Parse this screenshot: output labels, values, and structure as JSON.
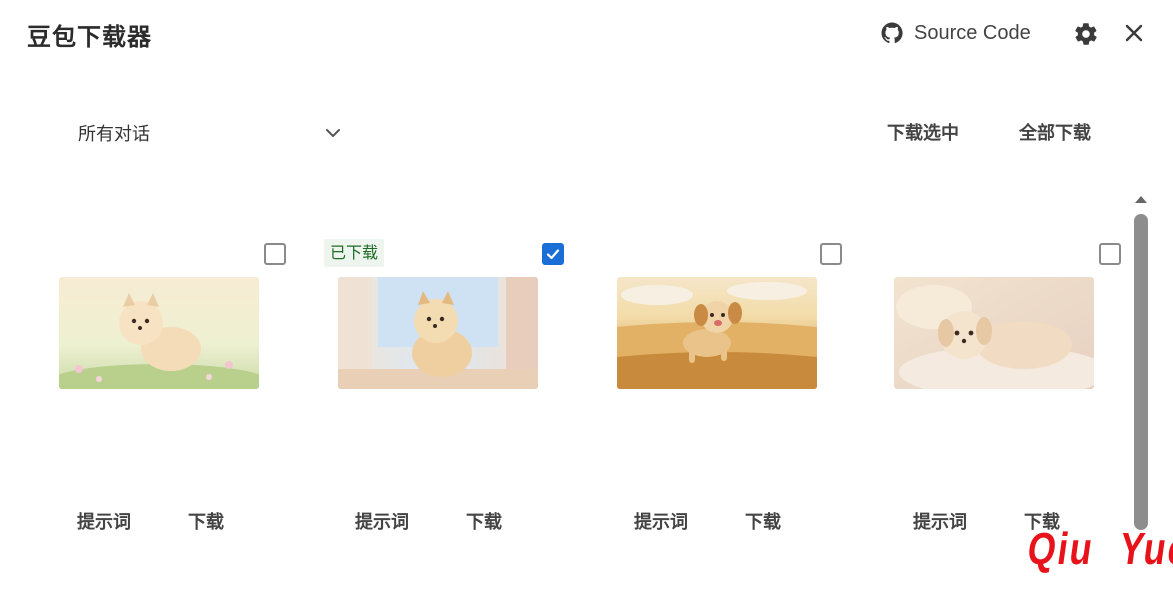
{
  "header": {
    "title": "豆包下载器",
    "source_code_label": "Source Code",
    "icons": {
      "github": "github-icon",
      "settings": "gear-icon",
      "close": "close-icon"
    }
  },
  "toolbar": {
    "conversation_filter": "所有对话",
    "download_selected_label": "下载选中",
    "download_all_label": "全部下载"
  },
  "cards": [
    {
      "checked": false,
      "downloaded": false,
      "badge": "",
      "prompt_label": "提示词",
      "download_label": "下载",
      "image_subject": "pomeranian-in-flower-field"
    },
    {
      "checked": true,
      "downloaded": true,
      "badge": "已下载",
      "prompt_label": "提示词",
      "download_label": "下载",
      "image_subject": "pomeranian-by-window"
    },
    {
      "checked": false,
      "downloaded": false,
      "badge": "",
      "prompt_label": "提示词",
      "download_label": "下载",
      "image_subject": "puppy-running-in-wheat-field"
    },
    {
      "checked": false,
      "downloaded": false,
      "badge": "",
      "prompt_label": "提示词",
      "download_label": "下载",
      "image_subject": "puppy-lying-on-pillow"
    }
  ],
  "colors": {
    "accent": "#1a6fd6",
    "badge_text": "#1f6b26",
    "watermark": "#e8131a"
  },
  "watermark": [
    "Qiu",
    "Yue"
  ]
}
